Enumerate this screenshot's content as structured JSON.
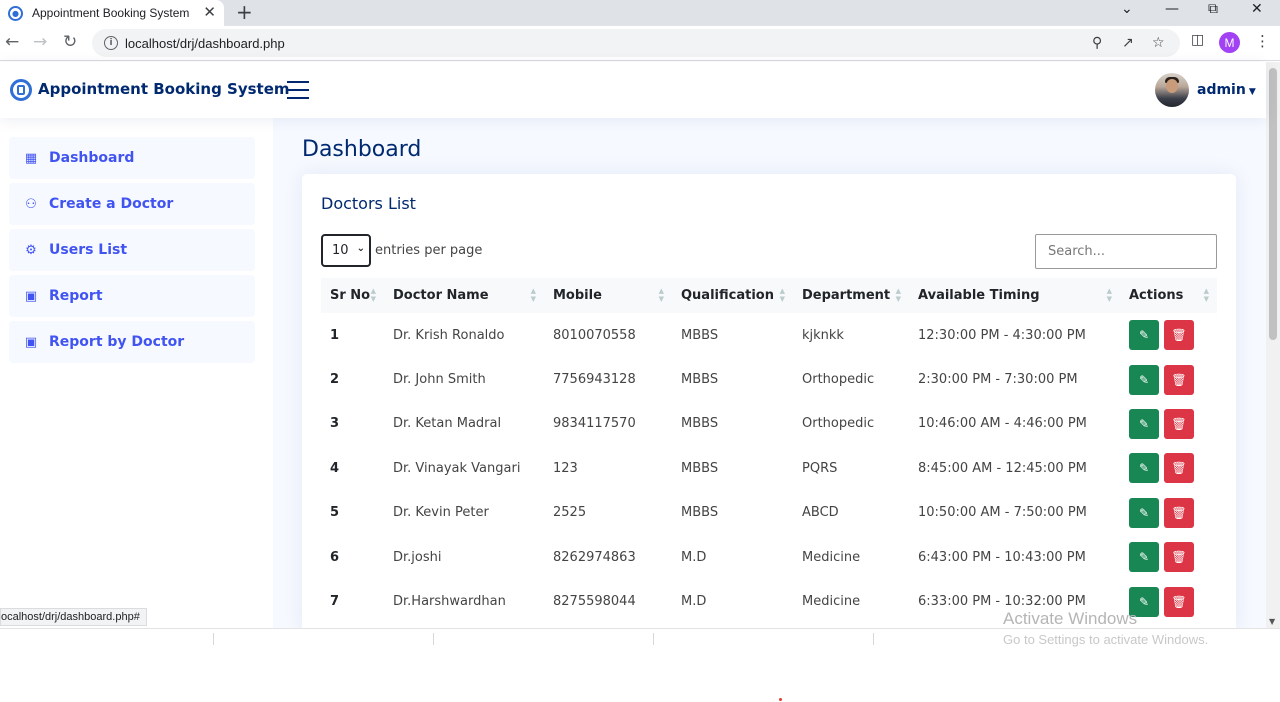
{
  "browser": {
    "tab_title": "Appointment Booking System",
    "url": "localhost/drj/dashboard.php",
    "profile_initial": "M",
    "status_url": "ocalhost/drj/dashboard.php#"
  },
  "header": {
    "app_name": "Appointment Booking System",
    "user_name": "admin"
  },
  "sidebar": {
    "items": [
      {
        "label": "Dashboard",
        "icon": "grid-icon"
      },
      {
        "label": "Create a Doctor",
        "icon": "user-plus-icon"
      },
      {
        "label": "Users List",
        "icon": "users-icon"
      },
      {
        "label": "Report",
        "icon": "calendar-icon"
      },
      {
        "label": "Report by Doctor",
        "icon": "calendar-icon"
      }
    ]
  },
  "main": {
    "page_title": "Dashboard",
    "card_title": "Doctors List",
    "entries_value": "10",
    "entries_label": "entries per page",
    "search_placeholder": "Search...",
    "columns": [
      "Sr No",
      "Doctor Name",
      "Mobile",
      "Qualification",
      "Department",
      "Available Timing",
      "Actions"
    ],
    "rows": [
      {
        "sr": "1",
        "name": "Dr. Krish Ronaldo",
        "mobile": "8010070558",
        "qual": "MBBS",
        "dept": "kjknkk",
        "timing": "12:30:00 PM - 4:30:00 PM"
      },
      {
        "sr": "2",
        "name": "Dr. John Smith",
        "mobile": "7756943128",
        "qual": "MBBS",
        "dept": "Orthopedic",
        "timing": "2:30:00 PM - 7:30:00 PM"
      },
      {
        "sr": "3",
        "name": "Dr. Ketan Madral",
        "mobile": "9834117570",
        "qual": "MBBS",
        "dept": "Orthopedic",
        "timing": "10:46:00 AM - 4:46:00 PM"
      },
      {
        "sr": "4",
        "name": "Dr. Vinayak Vangari",
        "mobile": "123",
        "qual": "MBBS",
        "dept": "PQRS",
        "timing": "8:45:00 AM - 12:45:00 PM"
      },
      {
        "sr": "5",
        "name": "Dr. Kevin Peter",
        "mobile": "2525",
        "qual": "MBBS",
        "dept": "ABCD",
        "timing": "10:50:00 AM - 7:50:00 PM"
      },
      {
        "sr": "6",
        "name": "Dr.joshi",
        "mobile": "8262974863",
        "qual": "M.D",
        "dept": "Medicine",
        "timing": "6:43:00 PM - 10:43:00 PM"
      },
      {
        "sr": "7",
        "name": "Dr.Harshwardhan",
        "mobile": "8275598044",
        "qual": "M.D",
        "dept": "Medicine",
        "timing": "6:33:00 PM - 10:32:00 PM"
      }
    ]
  },
  "overlay": {
    "activate_title": "Activate Windows",
    "activate_sub": "Go to Settings to activate Windows."
  },
  "colors": {
    "brand": "#012970",
    "accent": "#4154f1",
    "edit_button": "#198754",
    "delete_button": "#dc3545"
  }
}
